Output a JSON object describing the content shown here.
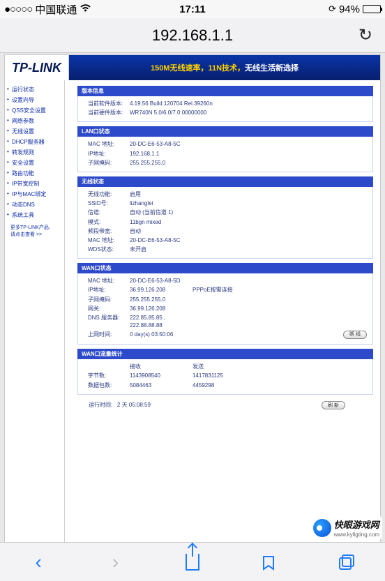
{
  "status": {
    "signal": "●○○○○",
    "carrier": "中国联通",
    "time": "17:11",
    "battery_pct": "94%"
  },
  "address_bar": {
    "url": "192.168.1.1"
  },
  "brand": {
    "logo": "TP-LINK",
    "slogan_yellow": "150M无线速率，11N技术，",
    "slogan_white": "无线生活新选择"
  },
  "sidebar": {
    "items": [
      "运行状态",
      "设置向导",
      "QSS安全设置",
      "网络参数",
      "无线设置",
      "DHCP服务器",
      "转发规则",
      "安全设置",
      "路由功能",
      "IP带宽控制",
      "IP与MAC绑定",
      "动态DNS",
      "系统工具"
    ],
    "more1": "更多TP-LINK产品,",
    "more2": "请点击查看 >>"
  },
  "panels": {
    "ver": {
      "title": "版本信息",
      "rows": [
        {
          "l": "当前软件版本:",
          "v": "4.19.56 Build 120704 Rel.39260n"
        },
        {
          "l": "当前硬件版本:",
          "v": "WR740N 5.0/6.0/7.0 00000000"
        }
      ]
    },
    "lan": {
      "title": "LAN口状态",
      "rows": [
        {
          "l": "MAC 地址:",
          "v": "20-DC-E6-53-A8-5C"
        },
        {
          "l": "IP地址:",
          "v": "192.168.1.1"
        },
        {
          "l": "子网掩码:",
          "v": "255.255.255.0"
        }
      ]
    },
    "wifi": {
      "title": "无线状态",
      "rows": [
        {
          "l": "无线功能:",
          "v": "启用"
        },
        {
          "l": "SSID号:",
          "v": "lizhanglei"
        },
        {
          "l": "信道:",
          "v": "自动 (当前信道 1)"
        },
        {
          "l": "模式:",
          "v": "11bgn mixed"
        },
        {
          "l": "频段带宽:",
          "v": "自动"
        },
        {
          "l": "MAC 地址:",
          "v": "20-DC-E6-53-A8-5C"
        },
        {
          "l": "WDS状态:",
          "v": "未开启"
        }
      ]
    },
    "wan": {
      "title": "WAN口状态",
      "rows": [
        {
          "l": "MAC 地址:",
          "v": "20-DC-E6-53-A8-5D",
          "v2": ""
        },
        {
          "l": "IP地址:",
          "v": "36.99.126.208",
          "v2": "PPPoE按需连接"
        },
        {
          "l": "子网掩码:",
          "v": "255.255.255.0",
          "v2": ""
        },
        {
          "l": "网关:",
          "v": "36.99.126.208",
          "v2": ""
        },
        {
          "l": "DNS 服务器:",
          "v": "222.85.85.85 , 222.88.88.88",
          "v2": ""
        },
        {
          "l": "上网时间:",
          "v": "0 day(s) 03:50:06",
          "v2": ""
        }
      ],
      "button": "断 线"
    },
    "traffic": {
      "title": "WAN口流量统计",
      "head": {
        "l": "",
        "v": "接收",
        "v2": "发送"
      },
      "rows": [
        {
          "l": "字节数:",
          "v": "1143908540",
          "v2": "1417831125"
        },
        {
          "l": "数据包数:",
          "v": "5084463",
          "v2": "4459298"
        }
      ]
    },
    "runtime": {
      "label": "运行时间:",
      "value": "2 天 05:08:59",
      "button": "刷 新"
    }
  },
  "watermark": {
    "name": "快眼游戏网",
    "url": "www.kyligting.com"
  }
}
